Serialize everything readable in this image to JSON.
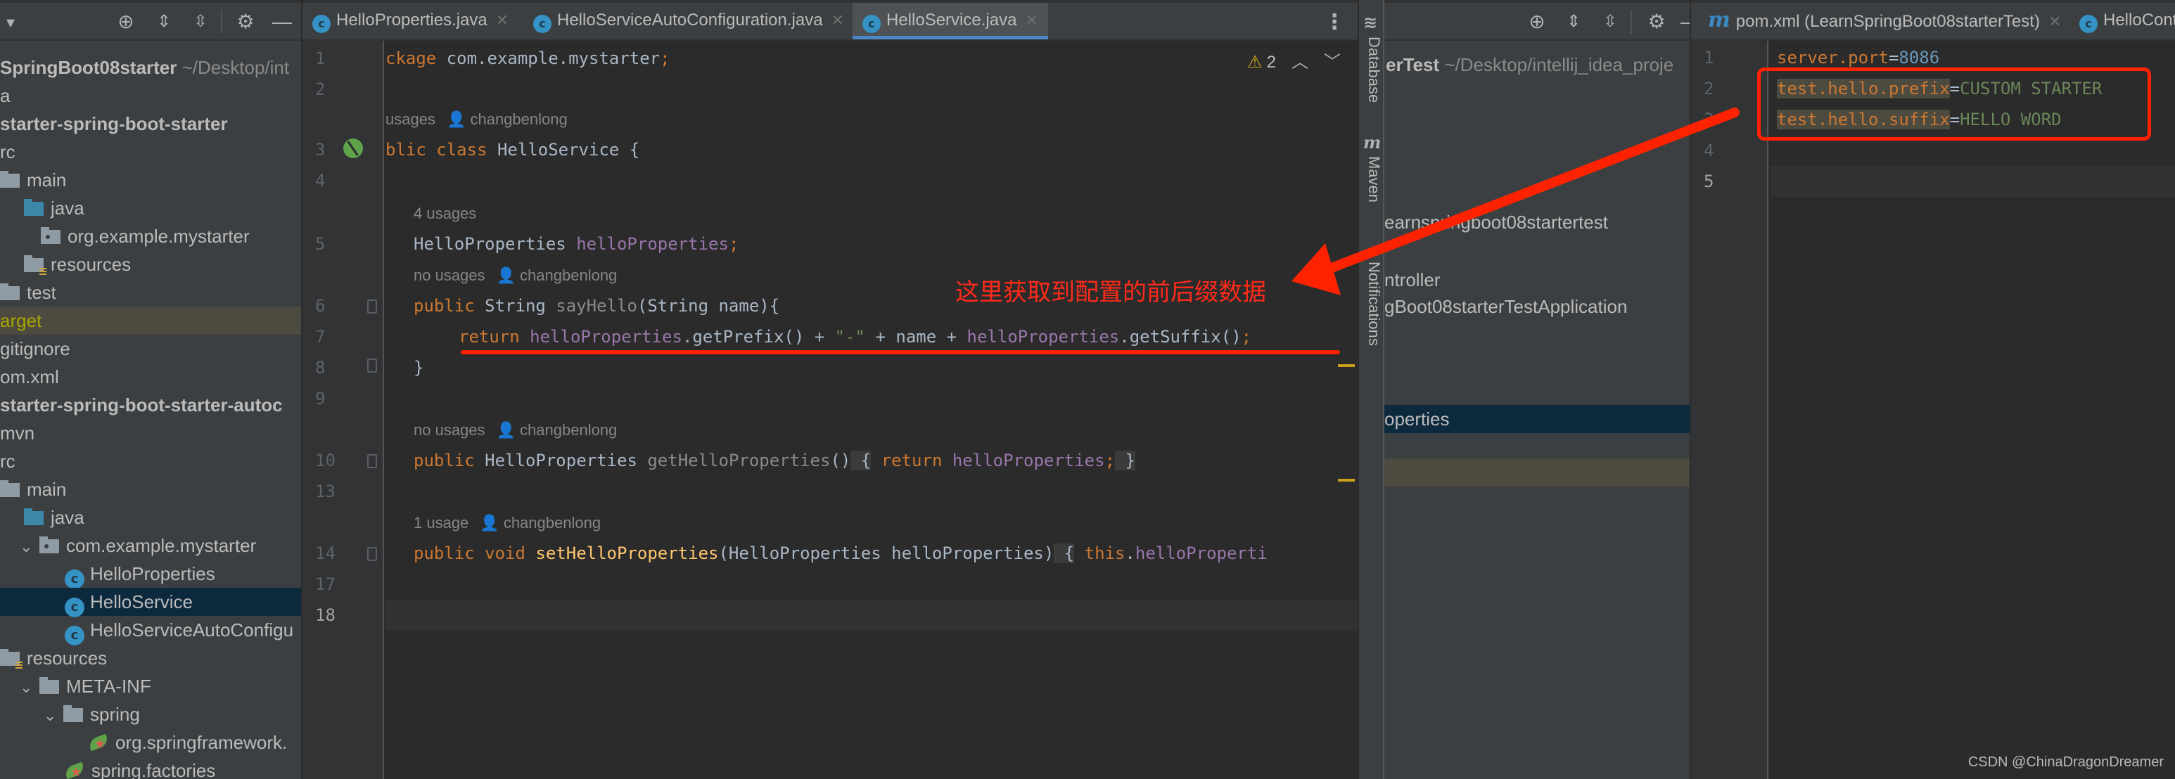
{
  "left_project": {
    "toolbar_icons": [
      "locate-icon",
      "expand-all-icon",
      "collapse-all-icon",
      "gear-icon",
      "hide-icon"
    ],
    "rows": [
      {
        "text": "SpringBoot08starter",
        "suffix": " ~/Desktop/int",
        "bold": true,
        "icon": "none"
      },
      {
        "text": "a",
        "icon": "none"
      },
      {
        "text": "starter-spring-boot-starter",
        "bold": true,
        "icon": "none"
      },
      {
        "text": "rc",
        "icon": "none"
      },
      {
        "text": "main",
        "icon": "folder"
      },
      {
        "text": "java",
        "icon": "folder-blue"
      },
      {
        "text": "org.example.mystarter",
        "icon": "package"
      },
      {
        "text": "resources",
        "icon": "resources"
      },
      {
        "text": "test",
        "icon": "folder"
      },
      {
        "text": "arget",
        "icon": "none",
        "state": "excluded"
      },
      {
        "text": "gitignore",
        "icon": "none"
      },
      {
        "text": "om.xml",
        "icon": "none"
      },
      {
        "text": "starter-spring-boot-starter-autoc",
        "bold": true,
        "icon": "none"
      },
      {
        "text": "mvn",
        "icon": "none"
      },
      {
        "text": "rc",
        "icon": "none"
      },
      {
        "text": "main",
        "icon": "folder"
      },
      {
        "text": "java",
        "icon": "folder-blue"
      },
      {
        "text": "com.example.mystarter",
        "icon": "package"
      },
      {
        "text": "HelloProperties",
        "icon": "class"
      },
      {
        "text": "HelloService",
        "icon": "class",
        "state": "selected"
      },
      {
        "text": "HelloServiceAutoConfigu",
        "icon": "class"
      },
      {
        "text": "resources",
        "icon": "resources"
      },
      {
        "text": "META-INF",
        "icon": "folder"
      },
      {
        "text": "spring",
        "icon": "folder"
      },
      {
        "text": "org.springframework.",
        "icon": "spring"
      },
      {
        "text": "spring.factories",
        "icon": "spring"
      }
    ]
  },
  "left_editor": {
    "tabs": [
      {
        "label": "HelloProperties.java",
        "active": false
      },
      {
        "label": "HelloServiceAutoConfiguration.java",
        "active": false
      },
      {
        "label": "HelloService.java",
        "active": true
      }
    ],
    "inspections": {
      "warnings": "2"
    },
    "line_numbers": [
      "1",
      "2",
      "3",
      "4",
      "5",
      "6",
      "7",
      "8",
      "9",
      "10",
      "13",
      "14",
      "17",
      "18"
    ],
    "hints": [
      {
        "usages": "usages",
        "author": "changbenlong"
      },
      {
        "usages": "4 usages",
        "author": ""
      },
      {
        "usages": "no usages",
        "author": "changbenlong"
      },
      {
        "usages": "no usages",
        "author": "changbenlong"
      },
      {
        "usages": "1 usage",
        "author": "changbenlong"
      }
    ],
    "code": {
      "l1": {
        "kw": "ckage",
        "rest": " com.example.mystarter",
        "semi": ";"
      },
      "l3": {
        "kw": "blic class",
        "rest": " HelloService {"
      },
      "l5": {
        "type": "HelloProperties ",
        "field": "helloProperties",
        "semi": ";"
      },
      "l6": {
        "kw": "public",
        "type": " String ",
        "method": "sayHello",
        "rest": "(String name){"
      },
      "l7": {
        "kw": "return",
        "f1": "helloProperties",
        "m1": ".getPrefix() + ",
        "str": "\"-\"",
        "m2": " + name + ",
        "f2": "helloProperties",
        "m3": ".getSuffix()",
        "semi": ";"
      },
      "l8": {
        "rest": "}"
      },
      "l10": {
        "kw": "public",
        "type": " HelloProperties ",
        "method": "getHelloProperties",
        "paren": "()",
        "ob": " {",
        "kw2": " return ",
        "field": "helloProperties",
        "semi": ";",
        "cb": " }"
      },
      "l14": {
        "kw": "public void ",
        "method": "setHelloProperties",
        "rest": "(HelloProperties helloProperties)",
        "ob": " {",
        "kw2": " this",
        "dot": ".",
        "field": "helloProperti"
      }
    }
  },
  "annotation": {
    "text": "这里获取到配置的前后缀数据",
    "color": "#ff2200"
  },
  "tool_stripe": {
    "items": [
      "Database",
      "Maven",
      "Notifications"
    ]
  },
  "right_project": {
    "toolbar_icons": [
      "locate-icon",
      "expand-all-icon",
      "collapse-all-icon",
      "gear-icon",
      "hide-icon"
    ],
    "rows": [
      {
        "text": "erTest",
        "suffix": " ~/Desktop/intellij_idea_proje",
        "bold": true
      },
      {
        "text": "earnspringboot08startertest"
      },
      {
        "text": "ntroller"
      },
      {
        "text": "gBoot08starterTestApplication"
      },
      {
        "text": "operties",
        "state": "selected"
      },
      {
        "text": "",
        "state": "excluded"
      }
    ]
  },
  "right_editor": {
    "tabs": [
      {
        "label": "pom.xml (LearnSpringBoot08starterTest)",
        "icon": "maven"
      },
      {
        "label": "HelloCont",
        "icon": "class"
      }
    ],
    "line_numbers": [
      "1",
      "2",
      "3",
      "4",
      "5"
    ],
    "lines": [
      {
        "key": "server.port",
        "eq": "=",
        "value": "8086",
        "value_type": "number"
      },
      {
        "key": "test.hello.prefix",
        "eq": "=",
        "value": "CUSTOM STARTER",
        "value_type": "string"
      },
      {
        "key": "test.hello.suffix",
        "eq": "=",
        "value": "HELLO WORD",
        "value_type": "string"
      }
    ]
  },
  "watermark": "CSDN @ChinaDragonDreamer"
}
